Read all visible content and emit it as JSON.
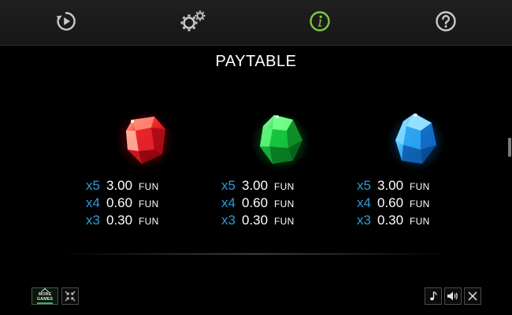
{
  "nav": {
    "items": [
      {
        "name": "replay-icon",
        "color": "#c9c9c9"
      },
      {
        "name": "settings-icon",
        "color": "#c9c9c9"
      },
      {
        "name": "info-icon",
        "color": "#7cc63f",
        "active": true
      },
      {
        "name": "help-icon",
        "color": "#c9c9c9"
      }
    ]
  },
  "title": "PAYTABLE",
  "symbols": [
    {
      "name": "red-gem",
      "color": "#e8262b",
      "pays": [
        {
          "mult": "x5",
          "amount": "3.00",
          "unit": "FUN"
        },
        {
          "mult": "x4",
          "amount": "0.60",
          "unit": "FUN"
        },
        {
          "mult": "x3",
          "amount": "0.30",
          "unit": "FUN"
        }
      ]
    },
    {
      "name": "green-gem",
      "color": "#1fd84a",
      "pays": [
        {
          "mult": "x5",
          "amount": "3.00",
          "unit": "FUN"
        },
        {
          "mult": "x4",
          "amount": "0.60",
          "unit": "FUN"
        },
        {
          "mult": "x3",
          "amount": "0.30",
          "unit": "FUN"
        }
      ]
    },
    {
      "name": "blue-gem",
      "color": "#27a8f2",
      "pays": [
        {
          "mult": "x5",
          "amount": "3.00",
          "unit": "FUN"
        },
        {
          "mult": "x4",
          "amount": "0.60",
          "unit": "FUN"
        },
        {
          "mult": "x3",
          "amount": "0.30",
          "unit": "FUN"
        }
      ]
    }
  ],
  "bottom": {
    "more_games_label": "MORE GAMES",
    "buttons": [
      "collapse-icon",
      "music-icon",
      "sound-icon",
      "close-icon"
    ]
  },
  "colors": {
    "multiplier": "#2f9bd8",
    "active_nav": "#7cc63f",
    "background": "#000000"
  }
}
